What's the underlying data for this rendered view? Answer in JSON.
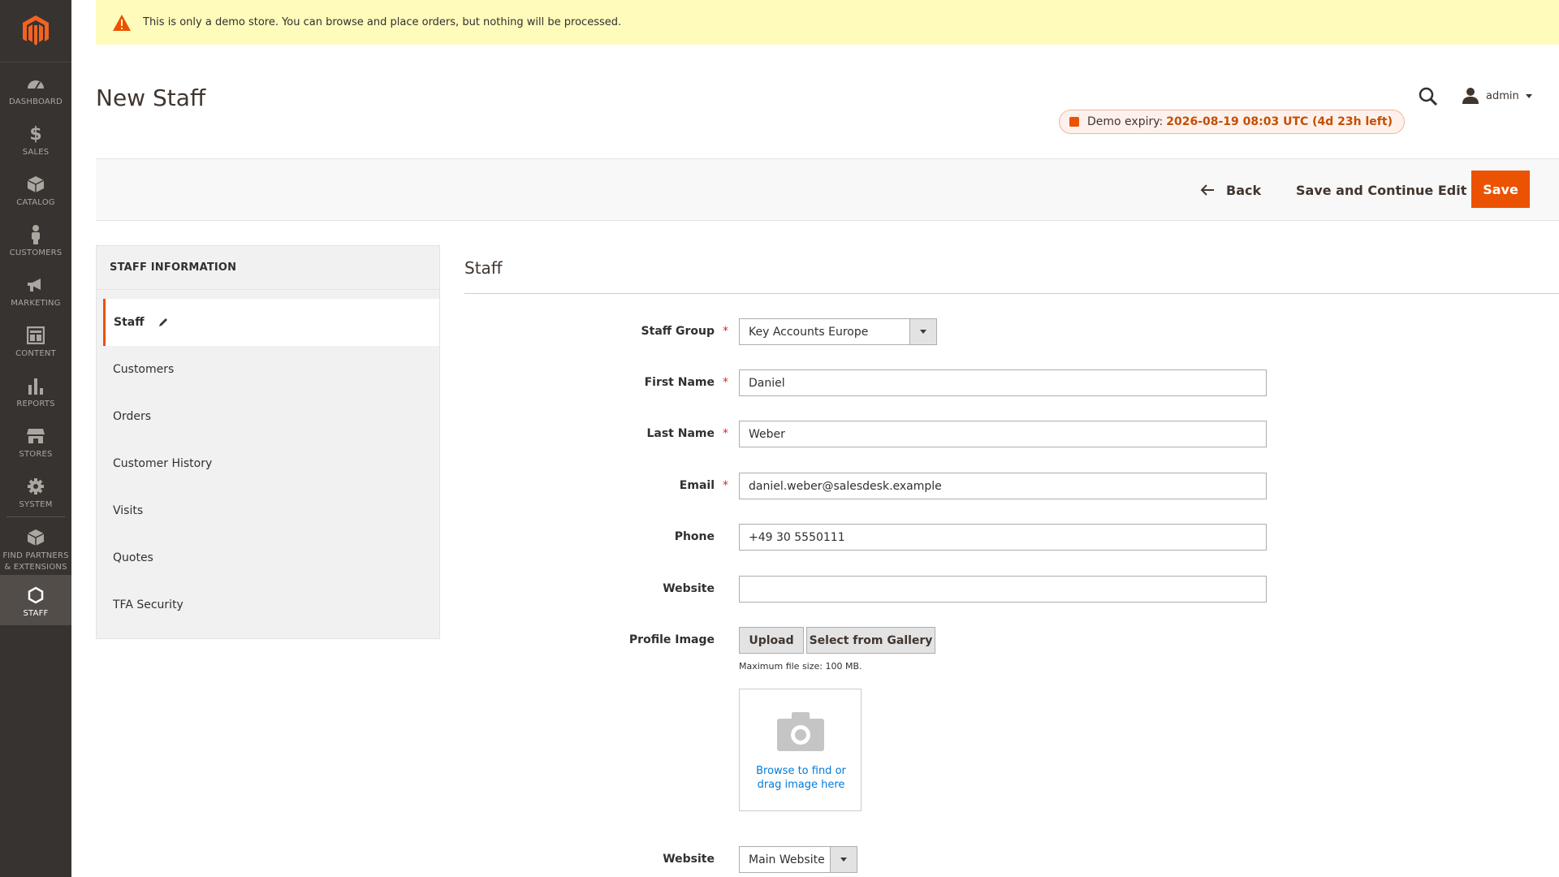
{
  "sidebar": {
    "items": [
      {
        "label": "DASHBOARD",
        "icon": "dashboard-icon"
      },
      {
        "label": "SALES",
        "icon": "dollar-icon"
      },
      {
        "label": "CATALOG",
        "icon": "box-icon"
      },
      {
        "label": "CUSTOMERS",
        "icon": "person-icon"
      },
      {
        "label": "MARKETING",
        "icon": "megaphone-icon"
      },
      {
        "label": "CONTENT",
        "icon": "layout-icon"
      },
      {
        "label": "REPORTS",
        "icon": "bar-chart-icon"
      },
      {
        "label": "STORES",
        "icon": "store-icon"
      },
      {
        "label": "SYSTEM",
        "icon": "gear-icon"
      },
      {
        "label": "FIND PARTNERS & EXTENSIONS",
        "icon": "cube-icon"
      },
      {
        "label": "STAFF",
        "icon": "hexagon-icon"
      }
    ],
    "active": "STAFF"
  },
  "notice": {
    "text": "This is only a demo store. You can browse and place orders, but nothing will be processed."
  },
  "header": {
    "title": "New Staff",
    "user": "admin",
    "demo_label": "Demo expiry:",
    "demo_value": "2026-08-19 08:03 UTC (4d 23h left)"
  },
  "actions": {
    "back": "Back",
    "save_continue": "Save and Continue Edit",
    "save": "Save"
  },
  "tabs": {
    "title": "STAFF INFORMATION",
    "items": [
      "Staff",
      "Customers",
      "Orders",
      "Customer History",
      "Visits",
      "Quotes",
      "TFA Security"
    ],
    "active": "Staff"
  },
  "form": {
    "section_title": "Staff",
    "staff_group": {
      "label": "Staff Group",
      "value": "Key Accounts Europe",
      "required": true
    },
    "first_name": {
      "label": "First Name",
      "value": "Daniel",
      "required": true
    },
    "last_name": {
      "label": "Last Name",
      "value": "Weber",
      "required": true
    },
    "email": {
      "label": "Email",
      "value": "daniel.weber@salesdesk.example",
      "required": true
    },
    "phone": {
      "label": "Phone",
      "value": "+49 30 5550111"
    },
    "website_url": {
      "label": "Website",
      "value": ""
    },
    "profile_image": {
      "label": "Profile Image",
      "upload": "Upload",
      "gallery": "Select from Gallery",
      "max_size": "Maximum file size: 100 MB.",
      "dropzone_text": "Browse to find or drag image here"
    },
    "website_select": {
      "label": "Website",
      "value": "Main Website"
    },
    "required_mark": "*"
  },
  "colors": {
    "accent": "#eb5202",
    "sidebar_bg": "#373330",
    "notice_bg": "#fffbbb",
    "link": "#007bdb"
  }
}
